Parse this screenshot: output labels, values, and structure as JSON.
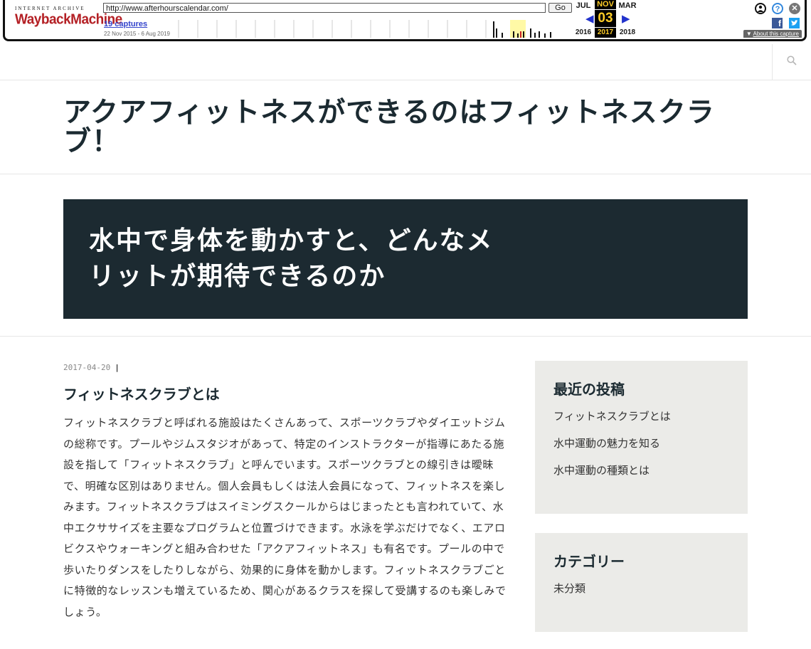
{
  "wayback": {
    "logo_top": "INTERNET ARCHIVE",
    "logo_main": "WaybackMachine",
    "url": "http://www.afterhourscalendar.com/",
    "go_label": "Go",
    "captures": "19 captures",
    "date_range": "22 Nov 2015 - 6 Aug 2019",
    "prev_month": "JUL",
    "current_month": "NOV",
    "next_month": "MAR",
    "current_day": "03",
    "prev_year": "2016",
    "current_year": "2017",
    "next_year": "2018",
    "about": "About this capture"
  },
  "site": {
    "title": "アクアフィットネスができるのはフィットネスクラブ！",
    "hero_title": "水中で身体を動かすと、どんなメリットが期待できるのか"
  },
  "post": {
    "date": "2017-04-20",
    "separator": "|",
    "title": "フィットネスクラブとは",
    "body": "フィットネスクラブと呼ばれる施設はたくさんあって、スポーツクラブやダイエットジムの総称です。プールやジムスタジオがあって、特定のインストラクターが指導にあたる施設を指して「フィットネスクラブ」と呼んでいます。スポーツクラブとの線引きは曖昧で、明確な区別はありません。個人会員もしくは法人会員になって、フィットネスを楽しみます。フィットネスクラブはスイミングスクールからはじまったとも言われていて、水中エクササイズを主要なプログラムと位置づけできます。水泳を学ぶだけでなく、エアロビクスやウォーキングと組み合わせた「アクアフィットネス」も有名です。プールの中で歩いたりダンスをしたりしながら、効果的に身体を動かします。フィットネスクラブごとに特徴的なレッスンも増えているため、関心があるクラスを探して受講するのも楽しみでしょう。"
  },
  "sidebar": {
    "recent_title": "最近の投稿",
    "recent": [
      {
        "label": "フィットネスクラブとは"
      },
      {
        "label": "水中運動の魅力を知る"
      },
      {
        "label": "水中運動の種類とは"
      }
    ],
    "category_title": "カテゴリー",
    "categories": [
      {
        "label": "未分類"
      }
    ]
  },
  "icons": {
    "search": "search-icon",
    "facebook": "facebook-icon",
    "twitter": "twitter-icon"
  }
}
